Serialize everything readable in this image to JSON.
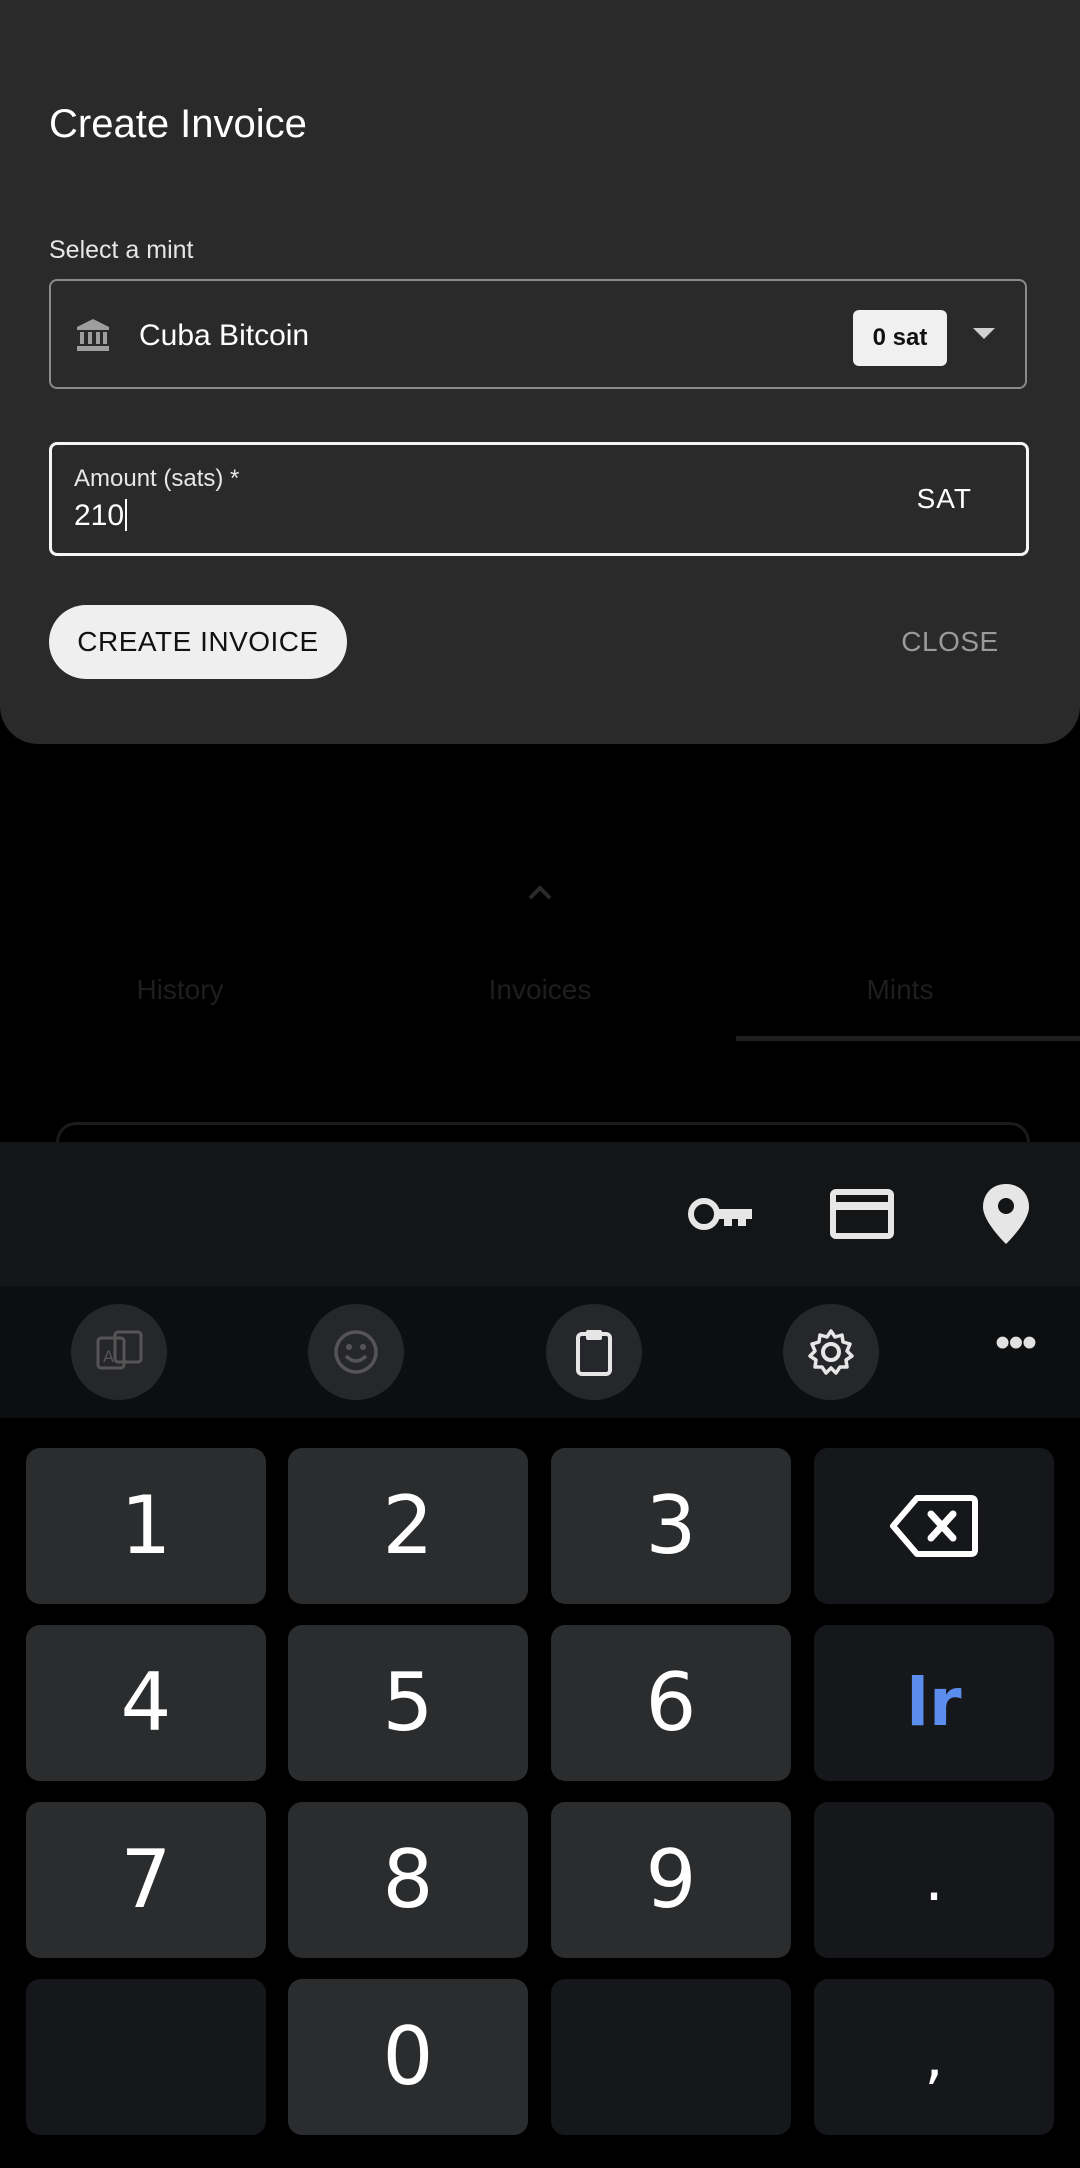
{
  "background": {
    "tabs": [
      "History",
      "Invoices",
      "Mints"
    ]
  },
  "dialog": {
    "title": "Create Invoice",
    "mint_label": "Select a mint",
    "mint_name": "Cuba Bitcoin",
    "mint_balance": "0 sat",
    "amount_label": "Amount (sats) *",
    "amount_value": "210",
    "unit": "SAT",
    "create_button": "CREATE INVOICE",
    "close_button": "CLOSE"
  },
  "keyboard": {
    "autofill_icons": [
      "key-icon",
      "credit-card-icon",
      "location-pin-icon"
    ],
    "toolbar_icons": [
      "translate-icon",
      "emoji-icon",
      "clipboard-icon",
      "settings-icon",
      "more-icon"
    ],
    "keys": {
      "k1": "1",
      "k2": "2",
      "k3": "3",
      "k4": "4",
      "k5": "5",
      "k6": "6",
      "k7": "7",
      "k8": "8",
      "k9": "9",
      "k0": "0",
      "lr": "lr",
      "period": ".",
      "comma": ","
    },
    "accent": "#5b8def"
  }
}
